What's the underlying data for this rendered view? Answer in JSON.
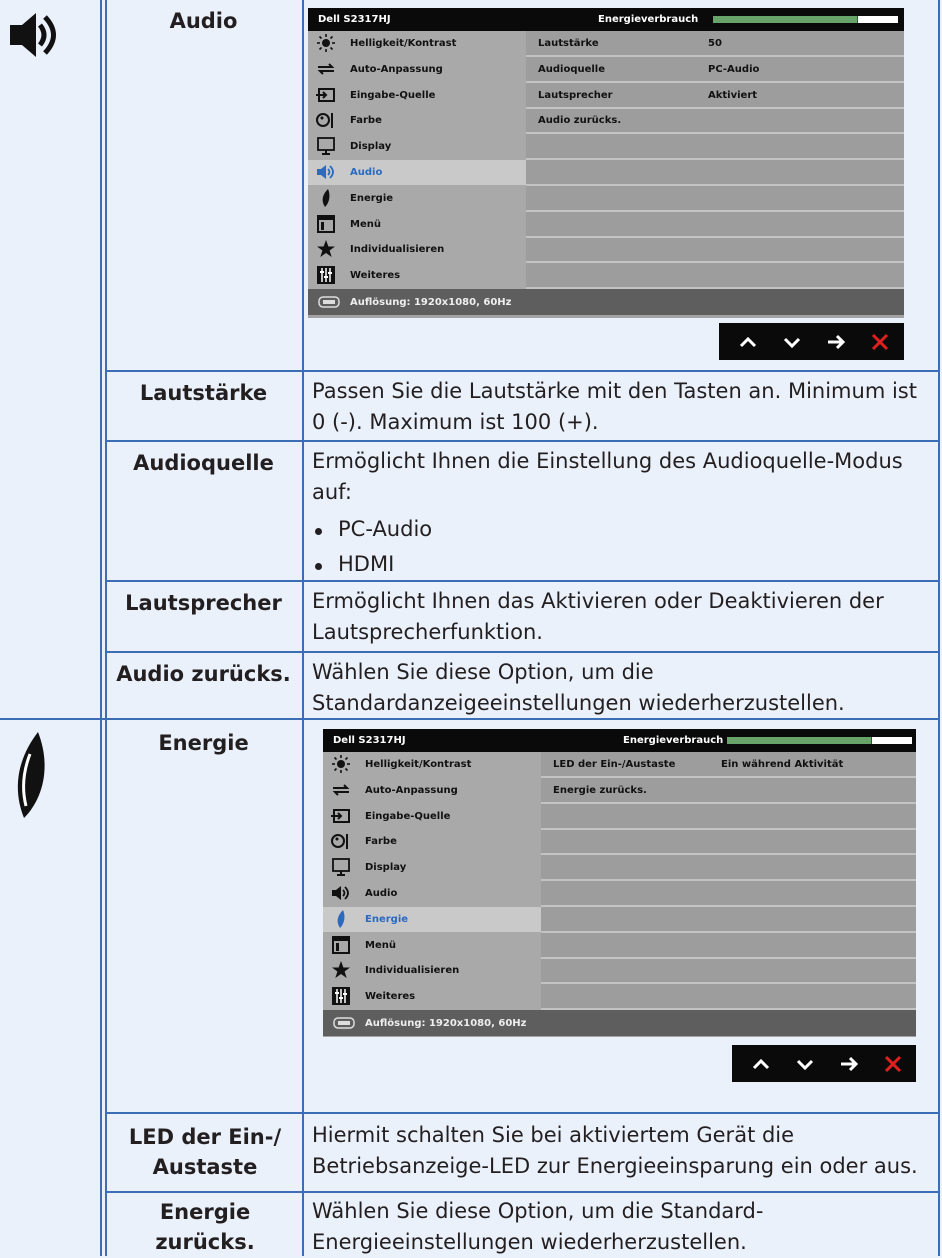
{
  "sections": [
    {
      "name": "Audio",
      "osd": {
        "model": "Dell S2317HJ",
        "energy_label": "Energieverbrauch",
        "menu": [
          {
            "label": "Helligkeit/Kontrast",
            "icon": "sun-icon"
          },
          {
            "label": "Auto-Anpassung",
            "icon": "auto-adjust-icon"
          },
          {
            "label": "Eingabe-Quelle",
            "icon": "input-source-icon"
          },
          {
            "label": "Farbe",
            "icon": "color-icon"
          },
          {
            "label": "Display",
            "icon": "display-icon"
          },
          {
            "label": "Audio",
            "icon": "speaker-icon"
          },
          {
            "label": "Energie",
            "icon": "energy-leaf-icon"
          },
          {
            "label": "Menü",
            "icon": "menu-icon"
          },
          {
            "label": "Individualisieren",
            "icon": "star-icon"
          },
          {
            "label": "Weiteres",
            "icon": "others-icon"
          }
        ],
        "selected_index": 5,
        "rows": [
          {
            "key": "Lautstärke",
            "value": "50"
          },
          {
            "key": "Audioquelle",
            "value": "PC-Audio"
          },
          {
            "key": "Lautsprecher",
            "value": "Aktiviert"
          },
          {
            "key": "Audio zurücks.",
            "value": ""
          }
        ],
        "resolution": "Auflösung: 1920x1080, 60Hz",
        "energy_level": 0.78
      },
      "items": [
        {
          "label": "Lautstärke",
          "desc": "Passen Sie die Lautstärke mit den Tasten an. Minimum ist 0 (-). Maximum ist 100 (+)."
        },
        {
          "label": "Audioquelle",
          "desc": "Ermöglicht Ihnen die Einstellung des Audioquelle-Modus auf:",
          "bullets": [
            "PC-Audio",
            "HDMI"
          ]
        },
        {
          "label": "Lautsprecher",
          "desc": "Ermöglicht Ihnen das Aktivieren oder Deaktivieren der Lautsprecherfunktion."
        },
        {
          "label": "Audio zurücks.",
          "desc": "Wählen Sie diese Option, um die Standardanzeigeeinstellungen wiederherzustellen."
        }
      ]
    },
    {
      "name": "Energie",
      "osd": {
        "model": "Dell S2317HJ",
        "energy_label": "Energieverbrauch",
        "selected_index": 6,
        "rows": [
          {
            "key": "LED der Ein-/Austaste",
            "value": "Ein während Aktivität"
          },
          {
            "key": "Energie zurücks.",
            "value": ""
          }
        ],
        "resolution": "Auflösung: 1920x1080, 60Hz",
        "energy_level": 0.78
      },
      "items": [
        {
          "label": "LED der Ein-/ Austaste",
          "desc": "Hiermit schalten Sie bei aktiviertem Gerät die Betriebsanzeige-LED zur Energieeinsparung ein oder aus."
        },
        {
          "label": "Energie zurücks.",
          "desc": "Wählen Sie diese Option, um die Standard-Energieeinstellungen wiederherzustellen."
        }
      ]
    }
  ],
  "nav_buttons": [
    "up-arrow-icon",
    "down-arrow-icon",
    "right-arrow-icon",
    "close-icon"
  ],
  "colors": {
    "rule": "#3b6eb4",
    "page_bg": "#eaf1fb",
    "highlight": "#2a6ac0",
    "close": "#e02020"
  }
}
